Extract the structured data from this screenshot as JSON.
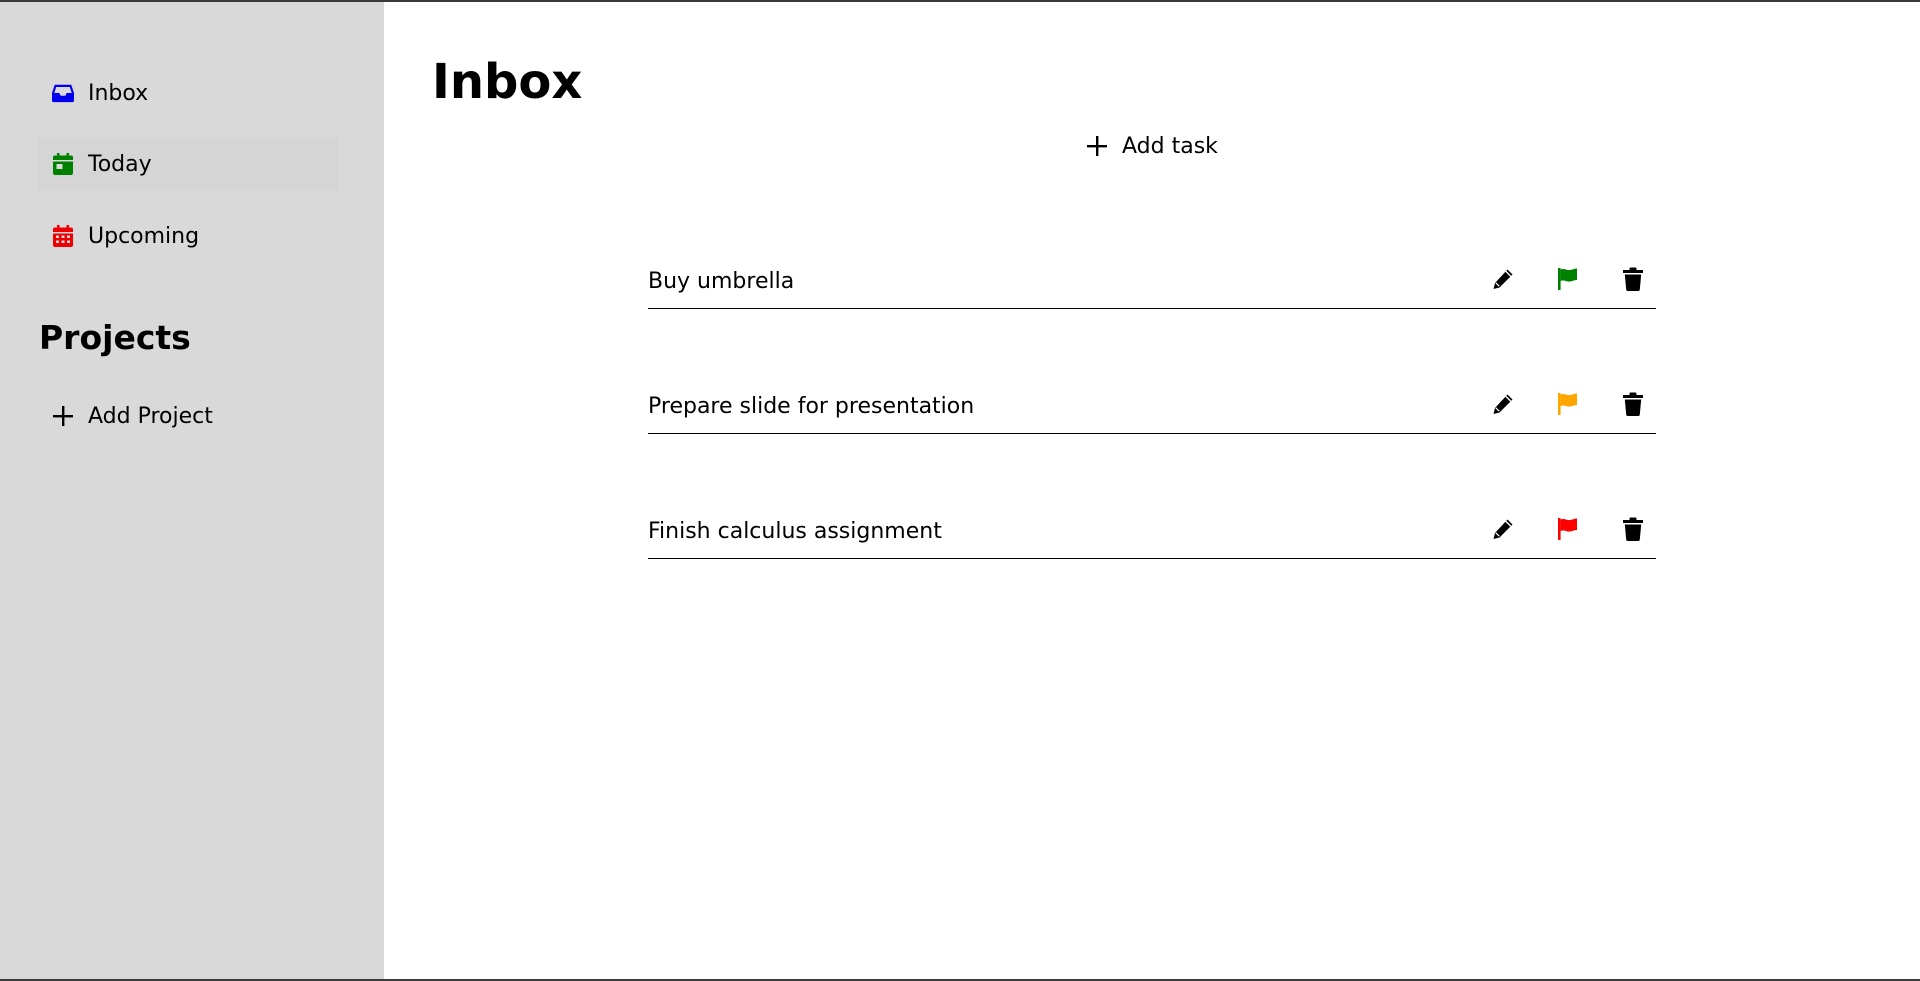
{
  "sidebar": {
    "nav": [
      {
        "label": "Inbox",
        "icon": "inbox-icon",
        "color": "#0000ee"
      },
      {
        "label": "Today",
        "icon": "calendar-today-icon",
        "color": "#008000"
      },
      {
        "label": "Upcoming",
        "icon": "calendar-upcoming-icon",
        "color": "#ee0000"
      }
    ],
    "projects_title": "Projects",
    "add_project_label": "Add Project"
  },
  "main": {
    "title": "Inbox",
    "add_task_label": "Add task",
    "tasks": [
      {
        "title": "Buy umbrella",
        "priority_color": "#008000"
      },
      {
        "title": "Prepare slide for presentation",
        "priority_color": "#ffa500"
      },
      {
        "title": "Finish calculus assignment",
        "priority_color": "#ff0000"
      }
    ]
  }
}
